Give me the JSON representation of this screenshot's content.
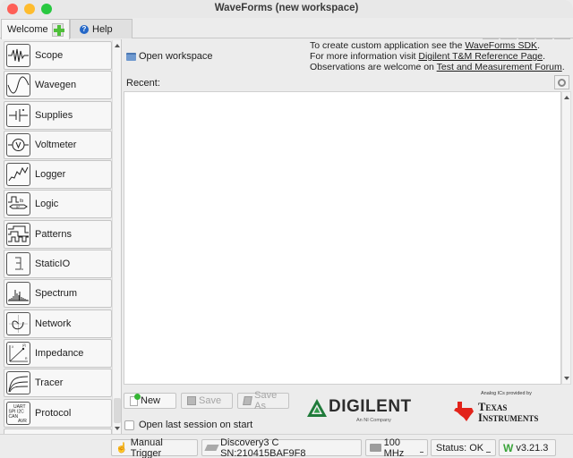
{
  "window": {
    "title": "WaveForms (new workspace)"
  },
  "tabs": [
    {
      "label": "Welcome",
      "icon": "plus-icon",
      "active": true
    },
    {
      "label": "Help",
      "icon": "help-icon",
      "active": false
    }
  ],
  "toolbar": {
    "buttons": [
      {
        "name": "run-all",
        "icon": "play-icon"
      },
      {
        "name": "stop-all",
        "icon": "stop-icon"
      },
      {
        "name": "windows",
        "icon": "windows-icon"
      },
      {
        "name": "split",
        "icon": "split-icon"
      },
      {
        "name": "settings",
        "icon": "gear-icon"
      }
    ]
  },
  "sidebar": {
    "items": [
      {
        "label": "Scope",
        "icon": "scope-icon"
      },
      {
        "label": "Wavegen",
        "icon": "wavegen-icon"
      },
      {
        "label": "Supplies",
        "icon": "supplies-icon"
      },
      {
        "label": "Voltmeter",
        "icon": "voltmeter-icon"
      },
      {
        "label": "Logger",
        "icon": "logger-icon"
      },
      {
        "label": "Logic",
        "icon": "logic-icon"
      },
      {
        "label": "Patterns",
        "icon": "patterns-icon"
      },
      {
        "label": "StaticIO",
        "icon": "staticio-icon"
      },
      {
        "label": "Spectrum",
        "icon": "spectrum-icon"
      },
      {
        "label": "Network",
        "icon": "network-icon"
      },
      {
        "label": "Impedance",
        "icon": "impedance-icon"
      },
      {
        "label": "Tracer",
        "icon": "tracer-icon"
      },
      {
        "label": "Protocol",
        "icon": "protocol-icon",
        "icon_text": [
          "UART",
          "SPI I2C",
          "CAN",
          "AVR"
        ]
      }
    ]
  },
  "main": {
    "open_workspace_label": "Open workspace",
    "info": {
      "line1_prefix": "To create custom application see the ",
      "line1_link": "WaveForms SDK",
      "line1_suffix": ".",
      "line2_prefix": "For more information visit ",
      "line2_link": "Digilent T&M Reference Page",
      "line2_suffix": ".",
      "line3_prefix": "Observations are welcome on ",
      "line3_link": "Test and Measurement Forum",
      "line3_suffix": "."
    },
    "recent_label": "Recent:",
    "recent_items": [],
    "buttons": {
      "new_label": "New",
      "save_label": "Save",
      "save_as_label": "Save As"
    },
    "open_last_session_label": "Open last session on start",
    "open_last_session_checked": false,
    "logos": {
      "digilent_word": "DIGILENT",
      "digilent_sub": "An NI Company",
      "ti_sub": "Analog ICs provided by",
      "ti_line1": "Texas",
      "ti_line2": "Instruments"
    },
    "colors": {
      "digilent_green": "#1f7a3a",
      "ti_red": "#e2231a"
    }
  },
  "statusbar": {
    "manual_trigger_label": "Manual Trigger",
    "device_label": "Discovery3 C SN:210415BAF9F8",
    "clock_label": "100 MHz",
    "status_label": "Status: OK",
    "version_label": "v3.21.3"
  }
}
